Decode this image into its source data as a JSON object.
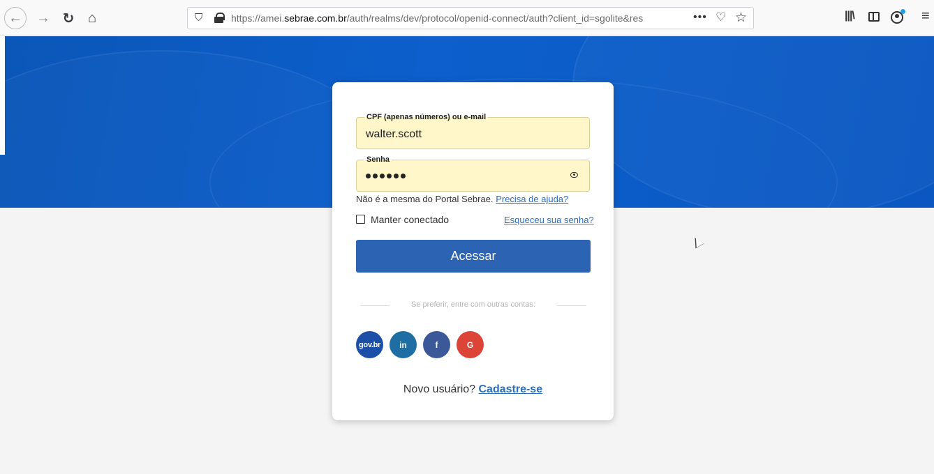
{
  "browser": {
    "back_icon": "←",
    "forward_icon": "→",
    "reload_icon": "↻",
    "home_icon": "⌂",
    "url_prefix": "https://amei.",
    "url_host": "sebrae.com.br",
    "url_rest": "/auth/realms/dev/protocol/openid-connect/auth?client_id=sgolite&res",
    "more_icon": "•••",
    "pocket_icon": "♡",
    "star_icon": "☆",
    "library_icon": "|||\\",
    "menu_icon": "≡"
  },
  "login": {
    "username_label": "CPF (apenas números) ou e-mail",
    "username_value": "walter.scott",
    "password_label": "Senha",
    "password_length": 6,
    "help_text": "Não é a mesma do Portal Sebrae.",
    "help_link": "Precisa de ajuda?",
    "remember_label": "Manter conectado",
    "forgot_link": "Esqueceu sua senha?",
    "submit_label": "Acessar",
    "divider_text": "Se preferir, entre com outras contas:",
    "signup_text": "Novo usuário?",
    "signup_link": "Cadastre-se"
  },
  "social": [
    {
      "label": "gov.br",
      "color": "#1b4fa8"
    },
    {
      "label": "in",
      "color": "#1e6ea3"
    },
    {
      "label": "f",
      "color": "#3b5998"
    },
    {
      "label": "G",
      "color": "#db4437"
    }
  ],
  "colors": {
    "hero": "#0c5fcc",
    "primary": "#2d63b3",
    "autofill": "#fff6c9"
  }
}
